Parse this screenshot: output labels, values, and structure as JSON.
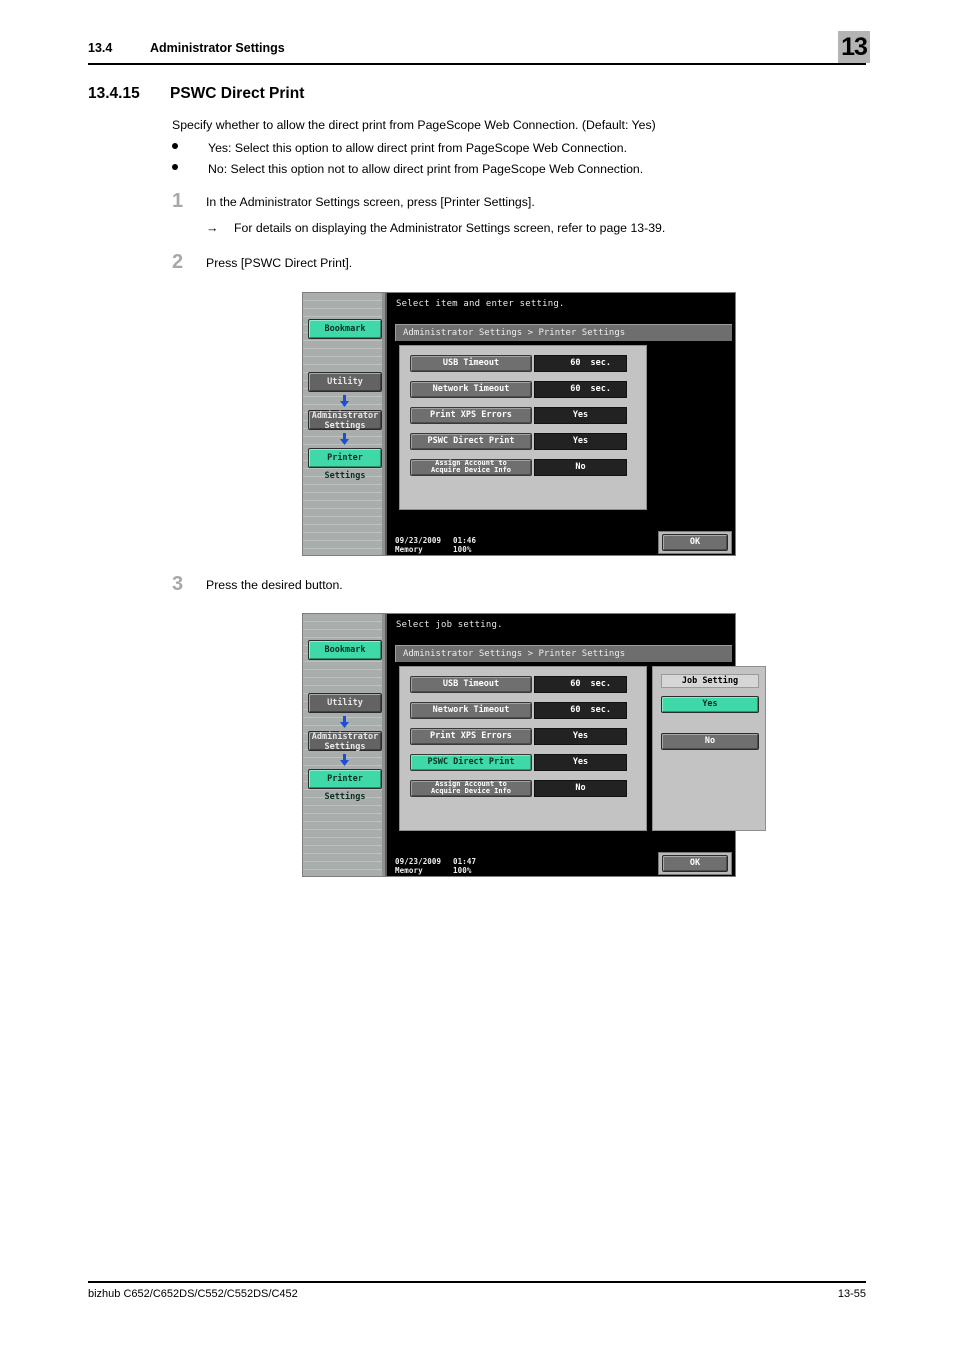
{
  "header": {
    "section_number": "13.4",
    "section_title": "Administrator Settings",
    "chapter_badge": "13"
  },
  "heading": {
    "number": "13.4.15",
    "title": "PSWC Direct Print"
  },
  "intro": "Specify whether to allow the direct print from PageScope Web Connection. (Default: Yes)",
  "bullets": [
    "Yes: Select this option to allow direct print from PageScope Web Connection.",
    "No: Select this option not to allow direct print from PageScope Web Connection."
  ],
  "steps": [
    {
      "number": "1",
      "text": "In the Administrator Settings screen, press [Printer Settings].",
      "substep": "For details on displaying the Administrator Settings screen, refer to page 13-39.",
      "substep_arrow": "→"
    },
    {
      "number": "2",
      "text": "Press [PSWC Direct Print]."
    },
    {
      "number": "3",
      "text": "Press the desired button."
    }
  ],
  "colors": {
    "accent_teal": "#3fd9a9",
    "button_gray": "#6f6f6f",
    "panel_gray": "#c3c3c3",
    "value_dark": "#222222",
    "arrow_blue": "#1a4fd6"
  },
  "screenshot1": {
    "prompt": "Select item and enter setting.",
    "breadcrumb": "Administrator Settings > Printer Settings",
    "rail": {
      "bookmark": "Bookmark",
      "utility": "Utility",
      "administrator_line1": "Administrator",
      "administrator_line2": "Settings",
      "printer_settings": "Printer Settings"
    },
    "rows": [
      {
        "label": "USB Timeout",
        "value_num": "60",
        "value_unit": "sec.",
        "selected": false,
        "two_line": false
      },
      {
        "label": "Network Timeout",
        "value_num": "60",
        "value_unit": "sec.",
        "selected": false,
        "two_line": false
      },
      {
        "label": "Print XPS Errors",
        "value": "Yes",
        "selected": false,
        "two_line": false
      },
      {
        "label": "PSWC Direct Print",
        "value": "Yes",
        "selected": false,
        "two_line": false
      },
      {
        "label_line1": "Assign Account to",
        "label_line2": "Acquire Device Info",
        "value": "No",
        "selected": false,
        "two_line": true
      }
    ],
    "status": {
      "date": "09/23/2009",
      "time": "01:46",
      "memory_label": "Memory",
      "memory_value": "100%"
    },
    "ok_label": "OK"
  },
  "screenshot2": {
    "prompt": "Select job setting.",
    "breadcrumb": "Administrator Settings > Printer Settings",
    "rail": {
      "bookmark": "Bookmark",
      "utility": "Utility",
      "administrator_line1": "Administrator",
      "administrator_line2": "Settings",
      "printer_settings": "Printer Settings"
    },
    "rows": [
      {
        "label": "USB Timeout",
        "value_num": "60",
        "value_unit": "sec.",
        "selected": false,
        "two_line": false
      },
      {
        "label": "Network Timeout",
        "value_num": "60",
        "value_unit": "sec.",
        "selected": false,
        "two_line": false
      },
      {
        "label": "Print XPS Errors",
        "value": "Yes",
        "selected": false,
        "two_line": false
      },
      {
        "label": "PSWC Direct Print",
        "value": "Yes",
        "selected": true,
        "two_line": false
      },
      {
        "label_line1": "Assign Account to",
        "label_line2": "Acquire Device Info",
        "value": "No",
        "selected": false,
        "two_line": true
      }
    ],
    "job_setting": {
      "title": "Job Setting",
      "options": [
        {
          "label": "Yes",
          "selected": true
        },
        {
          "label": "No",
          "selected": false
        }
      ]
    },
    "status": {
      "date": "09/23/2009",
      "time": "01:47",
      "memory_label": "Memory",
      "memory_value": "100%"
    },
    "ok_label": "OK"
  },
  "footer": {
    "models": "bizhub C652/C652DS/C552/C552DS/C452",
    "page": "13-55"
  }
}
